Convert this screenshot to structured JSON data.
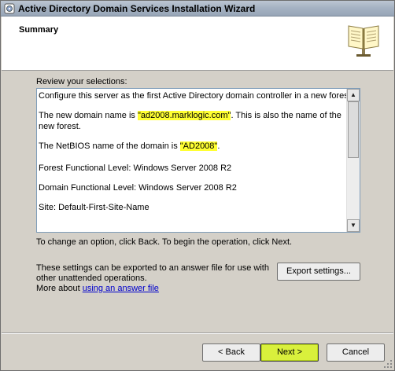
{
  "window": {
    "title": "Active Directory Domain Services Installation Wizard"
  },
  "header": {
    "title": "Summary"
  },
  "review_label": "Review your selections:",
  "summary": {
    "line1": "Configure this server as the first Active Directory domain controller in a new forest.",
    "domain_prefix": "The new domain name is ",
    "domain_value": "\"ad2008.marklogic.com\"",
    "domain_suffix": ". This is also the name of the",
    "domain_line2": "new forest.",
    "netbios_prefix": "The NetBIOS name of the domain is ",
    "netbios_value": "\"AD2008\"",
    "netbios_suffix": ".",
    "forest_level": "Forest Functional Level: Windows Server 2008 R2",
    "domain_level": "Domain Functional Level: Windows Server 2008 R2",
    "site": "Site: Default-First-Site-Name"
  },
  "instruction": "To change an option, click Back. To begin the operation, click Next.",
  "export": {
    "text_line1": "These settings can be exported to an answer file for use with",
    "text_line2": "other unattended operations.",
    "more_prefix": "More about ",
    "link": "using an answer file",
    "button": "Export settings..."
  },
  "buttons": {
    "back": "< Back",
    "next": "Next >",
    "cancel": "Cancel"
  },
  "colors": {
    "highlight": "#ffff33",
    "default_button": "#d9f03c",
    "link": "#0000cc"
  }
}
